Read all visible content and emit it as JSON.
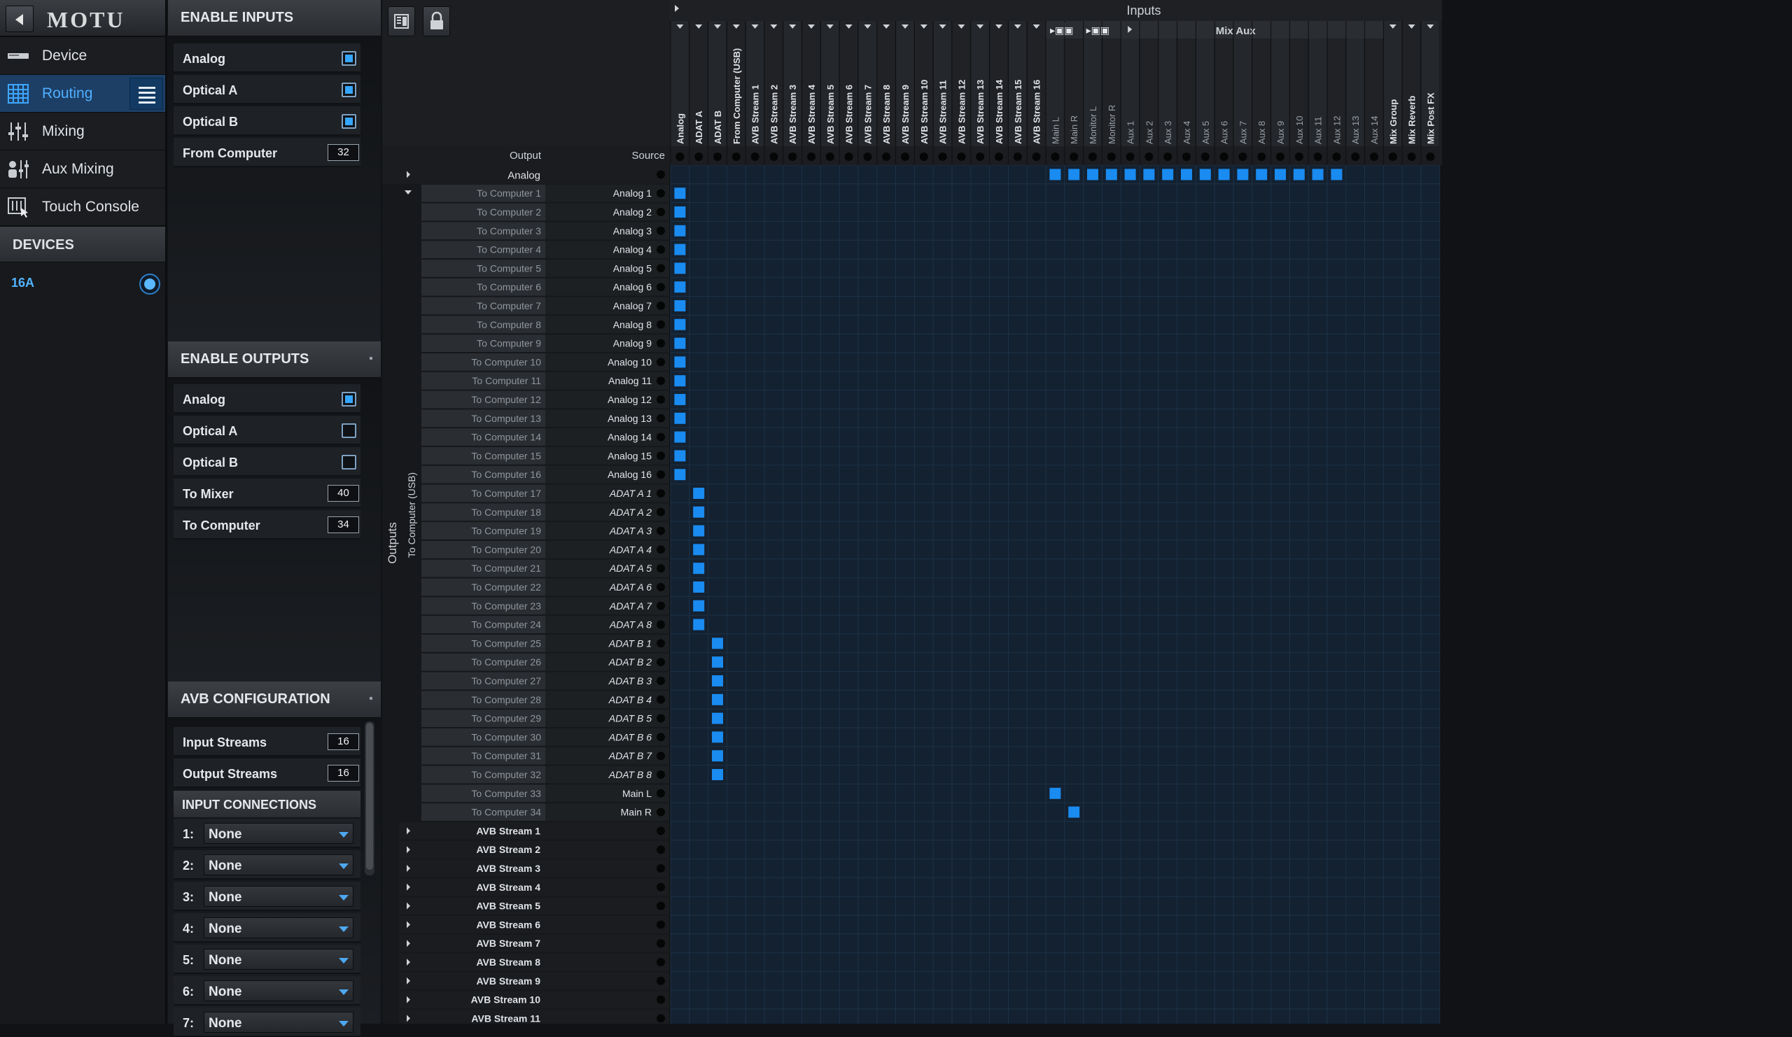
{
  "nav": {
    "logo": "MOTU",
    "items": [
      {
        "label": "Device",
        "icon": "device-icon"
      },
      {
        "label": "Routing",
        "icon": "grid-icon"
      },
      {
        "label": "Mixing",
        "icon": "faders-icon"
      },
      {
        "label": "Aux Mixing",
        "icon": "aux-mix-icon"
      },
      {
        "label": "Touch Console",
        "icon": "touch-console-icon"
      }
    ],
    "devices_header": "DEVICES",
    "device_name": "16A"
  },
  "enable_inputs": {
    "title": "ENABLE INPUTS",
    "analog": "Analog",
    "optical_a": "Optical A",
    "optical_b": "Optical B",
    "from_computer": "From Computer",
    "from_computer_value": "32",
    "analog_checked": true,
    "optical_a_checked": true,
    "optical_b_checked": true
  },
  "enable_outputs": {
    "title": "ENABLE OUTPUTS",
    "analog": "Analog",
    "optical_a": "Optical A",
    "optical_b": "Optical B",
    "to_mixer": "To Mixer",
    "to_mixer_value": "40",
    "to_computer": "To Computer",
    "to_computer_value": "34",
    "analog_checked": true,
    "optical_a_checked": false,
    "optical_b_checked": false
  },
  "avb": {
    "title": "AVB CONFIGURATION",
    "input_streams": "Input Streams",
    "input_streams_value": "16",
    "output_streams": "Output Streams",
    "output_streams_value": "16",
    "input_connections": "INPUT CONNECTIONS",
    "connections": [
      {
        "num": "1:",
        "value": "None"
      },
      {
        "num": "2:",
        "value": "None"
      },
      {
        "num": "3:",
        "value": "None"
      },
      {
        "num": "4:",
        "value": "None"
      },
      {
        "num": "5:",
        "value": "None"
      },
      {
        "num": "6:",
        "value": "None"
      },
      {
        "num": "7:",
        "value": "None"
      }
    ]
  },
  "matrix": {
    "inputs_title": "Inputs",
    "mix_aux_title": "Mix Aux",
    "output_header": "Output",
    "source_header": "Source",
    "outputs_vertical": "Outputs",
    "to_computer_group": "To Computer (USB)",
    "analog_row_label": "Analog",
    "columns": [
      "Analog",
      "ADAT A",
      "ADAT B",
      "From Computer (USB)",
      "AVB Stream 1",
      "AVB Stream 2",
      "AVB Stream 3",
      "AVB Stream 4",
      "AVB Stream 5",
      "AVB Stream 6",
      "AVB Stream 7",
      "AVB Stream 8",
      "AVB Stream 9",
      "AVB Stream 10",
      "AVB Stream 11",
      "AVB Stream 12",
      "AVB Stream 13",
      "AVB Stream 14",
      "AVB Stream 15",
      "AVB Stream 16",
      "Main L",
      "Main R",
      "Monitor L",
      "Monitor R",
      "Aux 1",
      "Aux 2",
      "Aux 3",
      "Aux 4",
      "Aux 5",
      "Aux 6",
      "Aux 7",
      "Aux 8",
      "Aux 9",
      "Aux 10",
      "Aux 11",
      "Aux 12",
      "Aux 13",
      "Aux 14",
      "Mix Group",
      "Mix Reverb",
      "Mix Post FX"
    ],
    "rows": [
      {
        "output": "To Computer 1",
        "source": "Analog 1",
        "route": 0
      },
      {
        "output": "To Computer 2",
        "source": "Analog 2",
        "route": 0
      },
      {
        "output": "To Computer 3",
        "source": "Analog 3",
        "route": 0
      },
      {
        "output": "To Computer 4",
        "source": "Analog 4",
        "route": 0
      },
      {
        "output": "To Computer 5",
        "source": "Analog 5",
        "route": 0
      },
      {
        "output": "To Computer 6",
        "source": "Analog 6",
        "route": 0
      },
      {
        "output": "To Computer 7",
        "source": "Analog 7",
        "route": 0
      },
      {
        "output": "To Computer 8",
        "source": "Analog 8",
        "route": 0
      },
      {
        "output": "To Computer 9",
        "source": "Analog 9",
        "route": 0
      },
      {
        "output": "To Computer 10",
        "source": "Analog 10",
        "route": 0
      },
      {
        "output": "To Computer 11",
        "source": "Analog 11",
        "route": 0
      },
      {
        "output": "To Computer 12",
        "source": "Analog 12",
        "route": 0
      },
      {
        "output": "To Computer 13",
        "source": "Analog 13",
        "route": 0
      },
      {
        "output": "To Computer 14",
        "source": "Analog 14",
        "route": 0
      },
      {
        "output": "To Computer 15",
        "source": "Analog 15",
        "route": 0
      },
      {
        "output": "To Computer 16",
        "source": "Analog 16",
        "route": 0
      },
      {
        "output": "To Computer 17",
        "source": "ADAT A 1",
        "route": 1
      },
      {
        "output": "To Computer 18",
        "source": "ADAT A 2",
        "route": 1
      },
      {
        "output": "To Computer 19",
        "source": "ADAT A 3",
        "route": 1
      },
      {
        "output": "To Computer 20",
        "source": "ADAT A 4",
        "route": 1
      },
      {
        "output": "To Computer 21",
        "source": "ADAT A 5",
        "route": 1
      },
      {
        "output": "To Computer 22",
        "source": "ADAT A 6",
        "route": 1
      },
      {
        "output": "To Computer 23",
        "source": "ADAT A 7",
        "route": 1
      },
      {
        "output": "To Computer 24",
        "source": "ADAT A 8",
        "route": 1
      },
      {
        "output": "To Computer 25",
        "source": "ADAT B 1",
        "route": 2
      },
      {
        "output": "To Computer 26",
        "source": "ADAT B 2",
        "route": 2
      },
      {
        "output": "To Computer 27",
        "source": "ADAT B 3",
        "route": 2
      },
      {
        "output": "To Computer 28",
        "source": "ADAT B 4",
        "route": 2
      },
      {
        "output": "To Computer 29",
        "source": "ADAT B 5",
        "route": 2
      },
      {
        "output": "To Computer 30",
        "source": "ADAT B 6",
        "route": 2
      },
      {
        "output": "To Computer 31",
        "source": "ADAT B 7",
        "route": 2
      },
      {
        "output": "To Computer 32",
        "source": "ADAT B 8",
        "route": 2
      },
      {
        "output": "To Computer 33",
        "source": "Main L",
        "route": 20
      },
      {
        "output": "To Computer 34",
        "source": "Main R",
        "route": 21
      }
    ],
    "avb_rows": [
      "AVB Stream 1",
      "AVB Stream 2",
      "AVB Stream 3",
      "AVB Stream 4",
      "AVB Stream 5",
      "AVB Stream 6",
      "AVB Stream 7",
      "AVB Stream 8",
      "AVB Stream 9",
      "AVB Stream 10",
      "AVB Stream 11"
    ],
    "analog_row_routes": [
      20,
      21,
      22,
      23,
      24,
      25,
      26,
      27,
      28,
      29,
      30,
      31,
      32,
      33,
      34,
      35
    ],
    "accent": "#1a8bf0"
  }
}
